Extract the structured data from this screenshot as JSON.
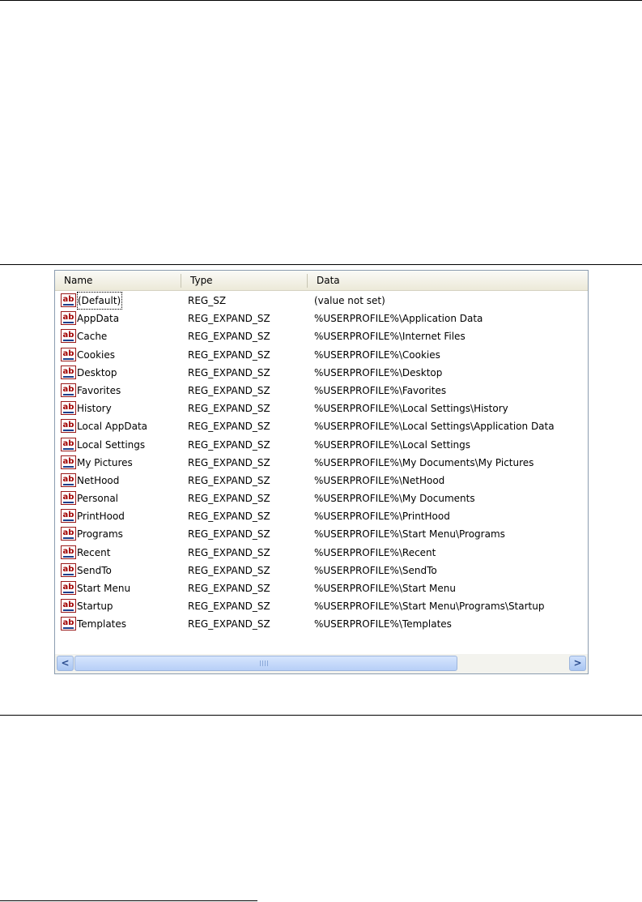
{
  "columns": {
    "name": "Name",
    "type": "Type",
    "data": "Data"
  },
  "icon": {
    "glyph": "ab",
    "name": "reg-string-icon",
    "color": "#a00000"
  },
  "rows": [
    {
      "name": "(Default)",
      "type": "REG_SZ",
      "data": "(value not set)"
    },
    {
      "name": "AppData",
      "type": "REG_EXPAND_SZ",
      "data": "%USERPROFILE%\\Application Data"
    },
    {
      "name": "Cache",
      "type": "REG_EXPAND_SZ",
      "data": "%USERPROFILE%\\Internet Files"
    },
    {
      "name": "Cookies",
      "type": "REG_EXPAND_SZ",
      "data": "%USERPROFILE%\\Cookies"
    },
    {
      "name": "Desktop",
      "type": "REG_EXPAND_SZ",
      "data": "%USERPROFILE%\\Desktop"
    },
    {
      "name": "Favorites",
      "type": "REG_EXPAND_SZ",
      "data": "%USERPROFILE%\\Favorites"
    },
    {
      "name": "History",
      "type": "REG_EXPAND_SZ",
      "data": "%USERPROFILE%\\Local Settings\\History"
    },
    {
      "name": "Local AppData",
      "type": "REG_EXPAND_SZ",
      "data": "%USERPROFILE%\\Local Settings\\Application Data"
    },
    {
      "name": "Local Settings",
      "type": "REG_EXPAND_SZ",
      "data": "%USERPROFILE%\\Local Settings"
    },
    {
      "name": "My Pictures",
      "type": "REG_EXPAND_SZ",
      "data": "%USERPROFILE%\\My Documents\\My Pictures"
    },
    {
      "name": "NetHood",
      "type": "REG_EXPAND_SZ",
      "data": "%USERPROFILE%\\NetHood"
    },
    {
      "name": "Personal",
      "type": "REG_EXPAND_SZ",
      "data": "%USERPROFILE%\\My Documents"
    },
    {
      "name": "PrintHood",
      "type": "REG_EXPAND_SZ",
      "data": "%USERPROFILE%\\PrintHood"
    },
    {
      "name": "Programs",
      "type": "REG_EXPAND_SZ",
      "data": "%USERPROFILE%\\Start Menu\\Programs"
    },
    {
      "name": "Recent",
      "type": "REG_EXPAND_SZ",
      "data": "%USERPROFILE%\\Recent"
    },
    {
      "name": "SendTo",
      "type": "REG_EXPAND_SZ",
      "data": "%USERPROFILE%\\SendTo"
    },
    {
      "name": "Start Menu",
      "type": "REG_EXPAND_SZ",
      "data": "%USERPROFILE%\\Start Menu"
    },
    {
      "name": "Startup",
      "type": "REG_EXPAND_SZ",
      "data": "%USERPROFILE%\\Start Menu\\Programs\\Startup"
    },
    {
      "name": "Templates",
      "type": "REG_EXPAND_SZ",
      "data": "%USERPROFILE%\\Templates"
    }
  ],
  "scrollbar": {
    "left_glyph": "<",
    "right_glyph": ">"
  }
}
